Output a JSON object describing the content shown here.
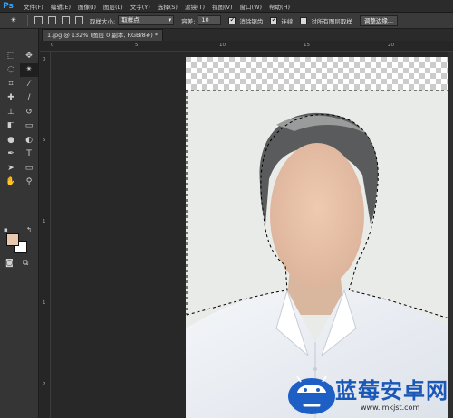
{
  "app": {
    "logo": "Ps"
  },
  "menu": [
    "文件(F)",
    "编辑(E)",
    "图像(I)",
    "图层(L)",
    "文字(Y)",
    "选择(S)",
    "滤镜(T)",
    "视图(V)",
    "窗口(W)",
    "帮助(H)"
  ],
  "options": {
    "sample_size_label": "取样大小:",
    "sample_size_value": "取样点",
    "tolerance_label": "容差:",
    "tolerance_value": "10",
    "antialias_label": "消除锯齿",
    "antialias_checked": true,
    "contiguous_label": "连续",
    "contiguous_checked": true,
    "sample_all_label": "对所有图层取样",
    "sample_all_checked": false,
    "refine_edge_button": "调整边缘..."
  },
  "document": {
    "tab_title": "1.jpg @ 132% (图层 0 副本, RGB/8#) *"
  },
  "rulers": {
    "top": [
      "0",
      "5",
      "10",
      "15",
      "20"
    ],
    "left": [
      "0",
      "5",
      "1",
      "1",
      "2"
    ]
  },
  "colors": {
    "foreground": "#e9c8b0",
    "background": "#ffffff",
    "accent": "#31a8ff",
    "watermark": "#1a58b8"
  },
  "tools": [
    "rect-marquee-icon",
    "move-icon",
    "lasso-icon",
    "magic-wand-icon",
    "crop-icon",
    "eyedropper-icon",
    "spot-heal-icon",
    "brush-icon",
    "clone-stamp-icon",
    "history-brush-icon",
    "eraser-icon",
    "gradient-icon",
    "blur-icon",
    "dodge-icon",
    "pen-icon",
    "type-icon",
    "path-select-icon",
    "shape-icon",
    "hand-icon",
    "zoom-icon"
  ],
  "watermark": {
    "title": "蓝莓安卓网",
    "url": "www.lmkjst.com"
  }
}
